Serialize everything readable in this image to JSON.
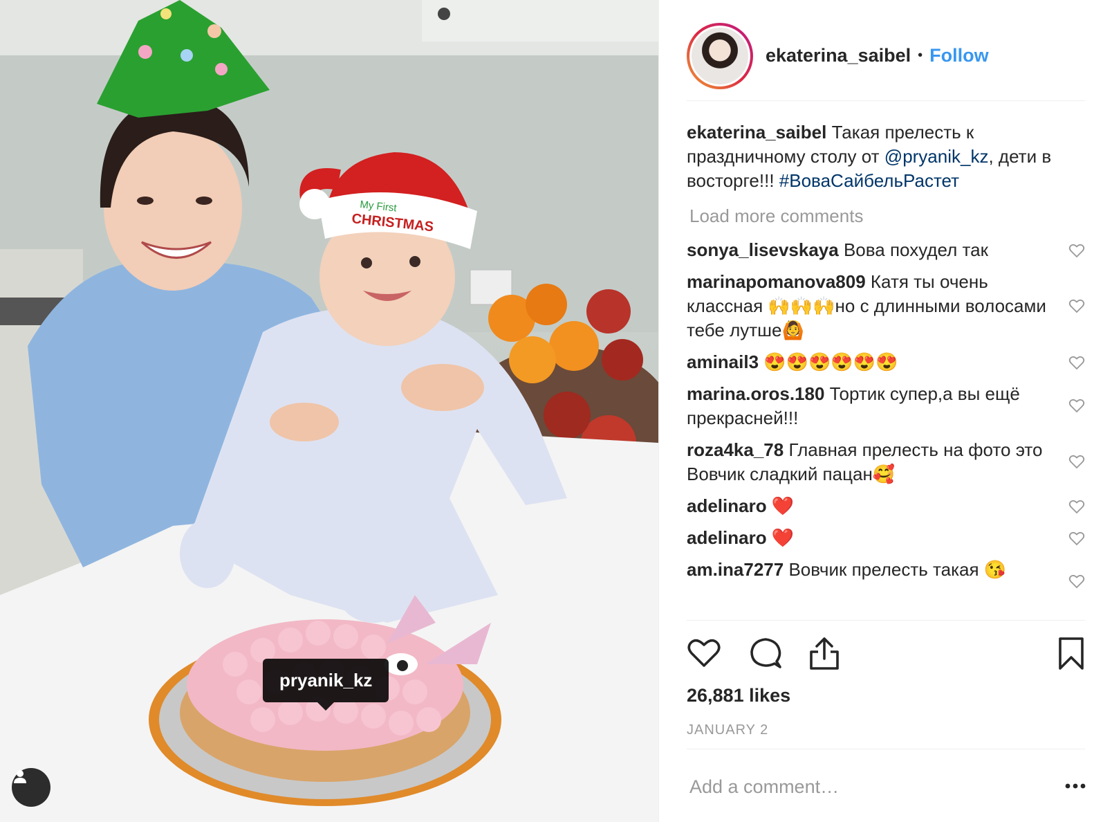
{
  "post": {
    "photo_tag": "pryanik_kz",
    "hat_text_line1": "My First",
    "hat_text_line2": "CHRISTMAS"
  },
  "header": {
    "username": "ekaterina_saibel",
    "separator": "•",
    "follow_label": "Follow"
  },
  "caption": {
    "username": "ekaterina_saibel",
    "text_part1": "Такая прелесть к праздничному столу от ",
    "mention": "@pryanik_kz",
    "text_part2": ", дети в восторге!!! ",
    "hashtag": "#ВоваСайбельРастет"
  },
  "load_more_label": "Load more comments",
  "comments": [
    {
      "username": "sonya_lisevskaya",
      "text": "Вова похудел так"
    },
    {
      "username": "marinapomanova809",
      "text": "Катя ты очень классная 🙌🙌🙌но с длинными волосами тебе лутше🙆"
    },
    {
      "username": "aminail3",
      "text": "😍😍😍😍😍😍"
    },
    {
      "username": "marina.oros.180",
      "text": "Тортик супер,а вы ещё прекрасней!!!"
    },
    {
      "username": "roza4ka_78",
      "text": "Главная прелесть на фото это Вовчик сладкий пацан🥰"
    },
    {
      "username": "adelinaro",
      "text": "❤️"
    },
    {
      "username": "adelinaro",
      "text": "❤️"
    },
    {
      "username": "am.ina7277",
      "text": "Вовчик прелесть такая 😘"
    }
  ],
  "likes": "26,881 likes",
  "date": "JANUARY 2",
  "add_comment_placeholder": "Add a comment…",
  "icons": {
    "like": "heart-icon",
    "comment": "comment-icon",
    "share": "share-icon",
    "save": "bookmark-icon",
    "options": "more-options-icon",
    "user_tags": "user-icon"
  },
  "colors": {
    "link": "#3897f0",
    "mention": "#003569",
    "muted": "#999999",
    "text": "#262626"
  }
}
